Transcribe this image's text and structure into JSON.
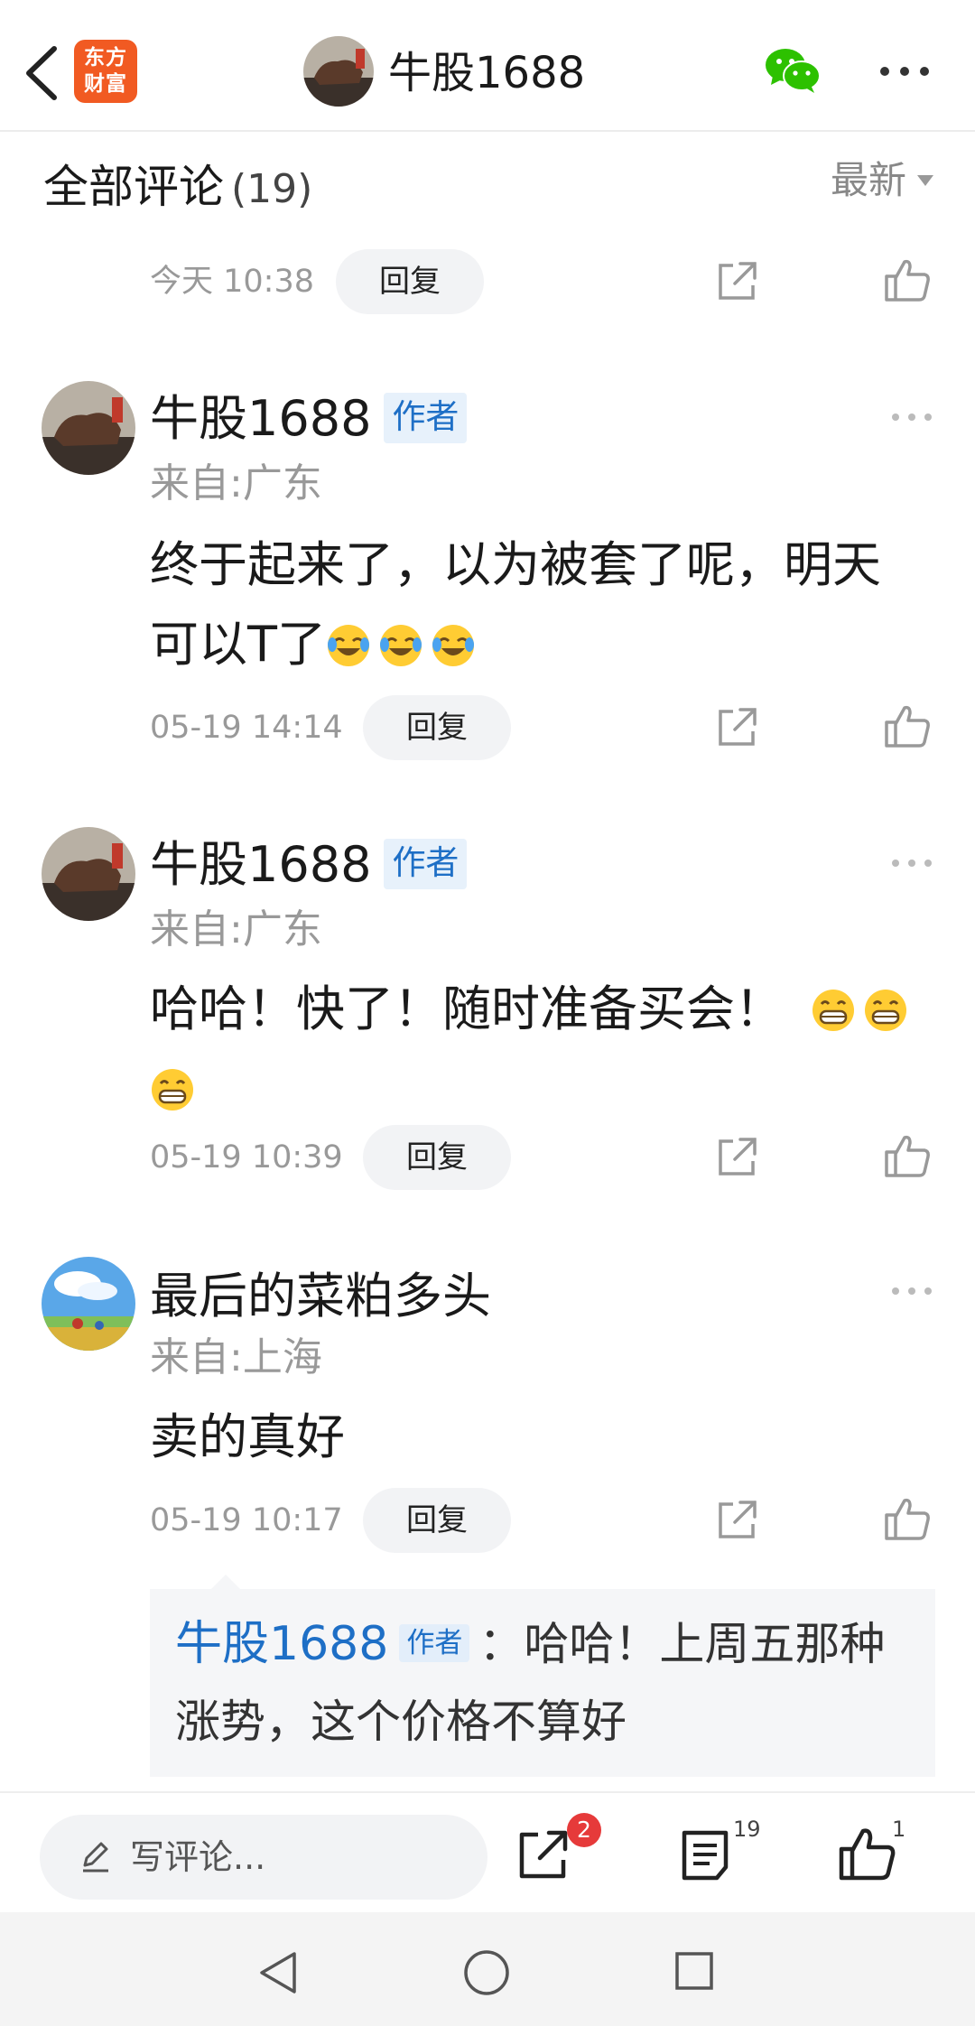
{
  "header": {
    "logo_text": "东方财富",
    "logo_line1": "东方",
    "logo_line2": "财富",
    "title": "牛股1688"
  },
  "section": {
    "title": "全部评论",
    "count": "(19)",
    "sort_label": "最新"
  },
  "first_item_meta": {
    "time": "今天 10:38",
    "reply_label": "回复"
  },
  "comments": [
    {
      "username": "牛股1688",
      "badge": "作者",
      "location": "来自:广东",
      "text_line1": "终于起来了，以为被套了呢，明天",
      "text_line2": "可以T了",
      "emoji": "laughing-crying-emoji",
      "time": "05-19 14:14",
      "reply_label": "回复"
    },
    {
      "username": "牛股1688",
      "badge": "作者",
      "location": "来自:广东",
      "text_line1": "哈哈！快了！随时准备买会！",
      "emoji": "grinning-emoji",
      "time": "05-19 10:39",
      "reply_label": "回复"
    },
    {
      "username": "最后的菜粕多头",
      "location": "来自:上海",
      "text_line1": "卖的真好",
      "time": "05-19 10:17",
      "reply_label": "回复",
      "reply": {
        "username": "牛股1688",
        "badge": "作者",
        "text_line1": "：哈哈！上周五那种",
        "text_line2": "涨势，这个价格不算好"
      }
    }
  ],
  "bottom_bar": {
    "input_placeholder": "写评论...",
    "share_badge": "2",
    "comments_count": "19",
    "likes_count": "1"
  },
  "colors": {
    "brand": "#f15a22",
    "author_blue": "#1e6fc6",
    "badge_red": "#e63a3a"
  }
}
